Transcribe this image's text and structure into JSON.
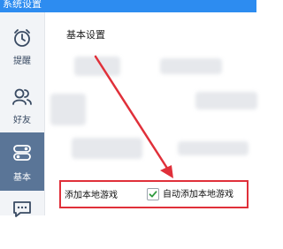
{
  "window": {
    "title": "系统设置"
  },
  "sidebar": {
    "items": [
      {
        "label": "提醒",
        "icon": "alarm-clock-icon"
      },
      {
        "label": "好友",
        "icon": "friends-icon"
      },
      {
        "label": "基本",
        "icon": "settings-toggle-icon",
        "active": true
      },
      {
        "label": "",
        "icon": "chat-icon"
      }
    ]
  },
  "main": {
    "section_title": "基本设置",
    "setting": {
      "label": "添加本地游戏",
      "checkbox_label": "自动添加本地游戏",
      "checked": true
    }
  },
  "colors": {
    "titlebar": "#2d8cf0",
    "sidebar_bg": "#f2f4f7",
    "active_nav": "#5a7597",
    "annotation": "#e0303a"
  }
}
